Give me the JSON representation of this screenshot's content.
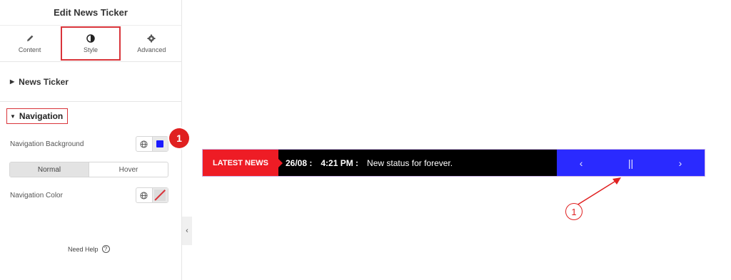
{
  "panel": {
    "title": "Edit News Ticker"
  },
  "tabs": [
    {
      "label": "Content",
      "icon": "pencil-icon"
    },
    {
      "label": "Style",
      "icon": "contrast-icon"
    },
    {
      "label": "Advanced",
      "icon": "gear-icon"
    }
  ],
  "sections": {
    "news_ticker": "News Ticker",
    "navigation": "Navigation"
  },
  "controls": {
    "nav_background_label": "Navigation Background",
    "nav_background_color": "#1a1aff",
    "state_normal": "Normal",
    "state_hover": "Hover",
    "nav_color_label": "Navigation Color"
  },
  "help": {
    "label": "Need Help",
    "icon": "question-icon"
  },
  "badge": {
    "number": "1"
  },
  "ticker": {
    "label": "LATEST NEWS",
    "date": "26/08 :",
    "time": "4:21 PM :",
    "headline": "New status for forever.",
    "prev": "‹",
    "pause": "||",
    "next": "›",
    "label_color": "#ee1c25",
    "nav_color": "#2a2aff"
  },
  "annotation": {
    "number": "1"
  }
}
